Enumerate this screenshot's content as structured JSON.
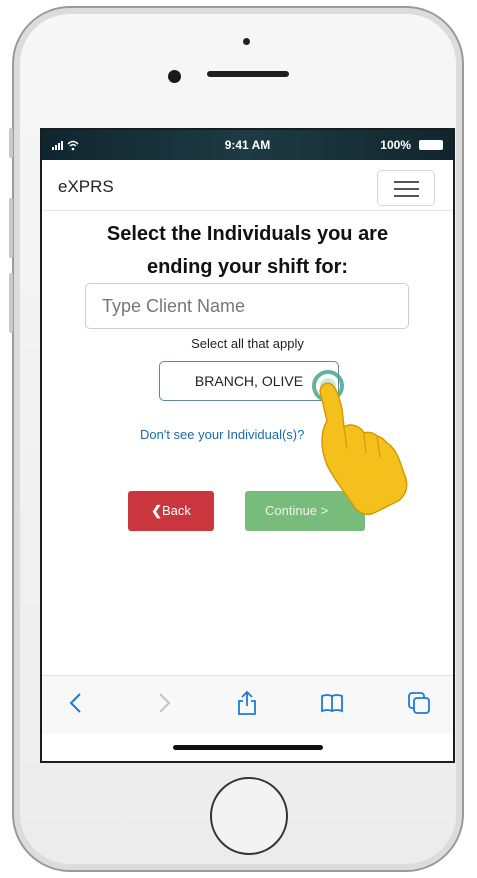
{
  "status_bar": {
    "time": "9:41 AM",
    "battery": "100%"
  },
  "navbar": {
    "brand": "eXPRS"
  },
  "page": {
    "heading_line1": "Select the Individuals you are",
    "heading_line2": "ending your shift for:",
    "search_placeholder": "Type Client Name",
    "hint": "Select all that apply",
    "client_option": "BRANCH, OLIVE",
    "missing_link": "Don't see your Individual(s)?",
    "back_label": "Back",
    "continue_label": "Continue >"
  },
  "icons": {
    "back": "chevron-left",
    "forward": "chevron-right",
    "share": "share",
    "bookmarks": "book",
    "tabs": "tabs"
  },
  "colors": {
    "back_button": "#c9363e",
    "continue_button": "#78bc7b",
    "link": "#1d6ba8",
    "hand": "#f6c01c"
  }
}
